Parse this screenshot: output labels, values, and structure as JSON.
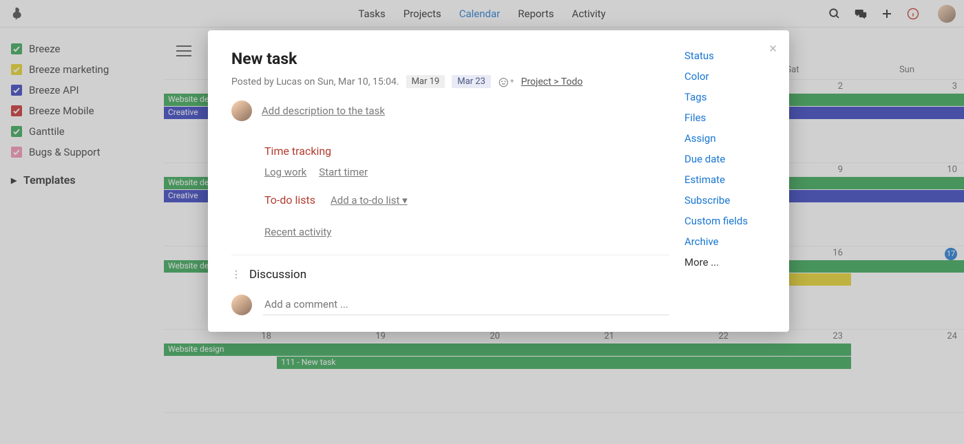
{
  "nav": {
    "items": [
      "Tasks",
      "Projects",
      "Calendar",
      "Reports",
      "Activity"
    ],
    "active_index": 2
  },
  "sidebar": {
    "projects": [
      {
        "label": "Breeze",
        "color": "#2fa44f"
      },
      {
        "label": "Breeze marketing",
        "color": "#e6d223"
      },
      {
        "label": "Breeze API",
        "color": "#2f3bbf"
      },
      {
        "label": "Breeze Mobile",
        "color": "#c62828"
      },
      {
        "label": "Ganttile",
        "color": "#2fa44f"
      },
      {
        "label": "Bugs & Support",
        "color": "#f48fb1"
      }
    ],
    "templates_label": "Templates"
  },
  "calendar": {
    "day_headers": [
      "Sat",
      "Sun"
    ],
    "weeks": [
      {
        "days": [
          "",
          "",
          "",
          "",
          "",
          "2",
          "3"
        ],
        "events": [
          {
            "label": "Website design",
            "cls": "green",
            "start": 0,
            "span": 7
          },
          {
            "label": "Creative",
            "cls": "blue",
            "start": 0,
            "span": 7
          }
        ]
      },
      {
        "days": [
          "",
          "",
          "",
          "",
          "",
          "9",
          "10"
        ],
        "events": [
          {
            "label": "Website design",
            "cls": "green",
            "start": 0,
            "span": 7
          },
          {
            "label": "Creative",
            "cls": "blue",
            "start": 0,
            "span": 7
          }
        ]
      },
      {
        "days": [
          "",
          "",
          "",
          "",
          "",
          "16",
          "17"
        ],
        "today_col": 6,
        "events": [
          {
            "label": "Website design",
            "cls": "green",
            "start": 0,
            "span": 7
          },
          {
            "label": "",
            "cls": "yellow",
            "start": 5,
            "span": 1
          }
        ]
      },
      {
        "days": [
          "18",
          "19",
          "20",
          "21",
          "22",
          "23",
          "24"
        ],
        "events": [
          {
            "label": "Website design",
            "cls": "green",
            "start": 0,
            "span": 6
          },
          {
            "label": "111 - New task",
            "cls": "green",
            "start": 1,
            "span": 5
          }
        ]
      }
    ]
  },
  "modal": {
    "title": "New task",
    "posted": "Posted by Lucas on Sun, Mar 10, 15:04.",
    "start_date": "Mar 19",
    "end_date": "Mar 23",
    "breadcrumb": "Project > Todo",
    "add_description": "Add description to the task",
    "time_tracking": "Time tracking",
    "log_work": "Log work",
    "start_timer": "Start timer",
    "todo_lists": "To-do lists",
    "add_todo": "Add a to-do list",
    "recent_activity": "Recent activity",
    "discussion": "Discussion",
    "comment_placeholder": "Add a comment ...",
    "side_items": [
      "Status",
      "Color",
      "Tags",
      "Files",
      "Assign",
      "Due date",
      "Estimate",
      "Subscribe",
      "Custom fields",
      "Archive"
    ],
    "more": "More ..."
  }
}
